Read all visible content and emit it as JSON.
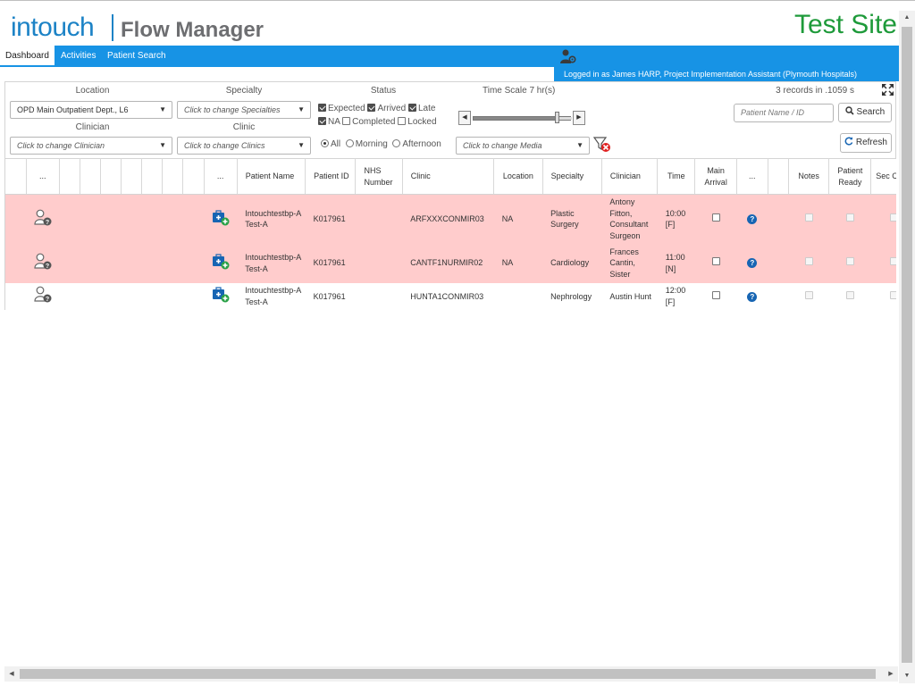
{
  "header": {
    "logo_main": "intouch",
    "logo_product": "Flow Manager",
    "site_label": "Test Site"
  },
  "nav": {
    "tabs": [
      {
        "label": "Dashboard",
        "active": true
      },
      {
        "label": "Activities",
        "active": false
      },
      {
        "label": "Patient Search",
        "active": false
      }
    ],
    "user_text": "Logged in as James HARP, Project Implementation Assistant (Plymouth Hospitals)"
  },
  "filters": {
    "location_label": "Location",
    "location_value": "OPD Main Outpatient Dept., L6",
    "specialty_label": "Specialty",
    "specialty_placeholder": "Click to change Specialties",
    "clinician_label": "Clinician",
    "clinician_placeholder": "Click to change Clinician",
    "clinic_label": "Clinic",
    "clinic_placeholder": "Click to change Clinics",
    "status_label": "Status",
    "status_options": [
      {
        "label": "Expected",
        "checked": true
      },
      {
        "label": "Arrived",
        "checked": true
      },
      {
        "label": "Late",
        "checked": true
      },
      {
        "label": "NA",
        "checked": true
      },
      {
        "label": "Completed",
        "checked": false
      },
      {
        "label": "Locked",
        "checked": false
      }
    ],
    "time_scale_label": "Time Scale",
    "time_scale_value": "7",
    "time_scale_unit": "hr(s)",
    "time_scale_fraction": 0.86,
    "session_options": [
      {
        "label": "All",
        "selected": true
      },
      {
        "label": "Morning",
        "selected": false
      },
      {
        "label": "Afternoon",
        "selected": false
      }
    ],
    "media_placeholder": "Click to change Media",
    "records_info": "3 records in .1059 s",
    "patient_search_placeholder": "Patient Name / ID",
    "search_button": "Search",
    "refresh_button": "Refresh"
  },
  "grid": {
    "columns": [
      "...",
      "...",
      "Patient Name",
      "Patient ID",
      "NHS Number",
      "Clinic",
      "Location",
      "Specialty",
      "Clinician",
      "Time",
      "Main Arrival",
      "...",
      "Notes",
      "Patient Ready",
      "Sec Clinic"
    ],
    "rows": [
      {
        "patient_name": "Intouchtestbp-A Test-A",
        "patient_id": "K017961",
        "nhs": "",
        "clinic": "ARFXXXCONMIR03",
        "location": "NA",
        "specialty": "Plastic Surgery",
        "clinician": "Antony Fitton, Consultant Surgeon",
        "time": "10:00 [F]",
        "late": true
      },
      {
        "patient_name": "Intouchtestbp-A Test-A",
        "patient_id": "K017961",
        "nhs": "",
        "clinic": "CANTF1NURMIR02",
        "location": "NA",
        "specialty": "Cardiology",
        "clinician": "Frances Cantin, Sister",
        "time": "11:00 [N]",
        "late": true
      },
      {
        "patient_name": "Intouchtestbp-A Test-A",
        "patient_id": "K017961",
        "nhs": "",
        "clinic": "HUNTA1CONMIR03",
        "location": "",
        "specialty": "Nephrology",
        "clinician": "Austin Hunt",
        "time": "12:00 [F]",
        "late": false
      }
    ]
  },
  "icons": {
    "user_settings": "user-gear-icon",
    "clear_filter": "filter-clear-icon",
    "expand": "expand-icon",
    "refresh": "refresh-icon",
    "patient": "patient-unknown-icon",
    "kit": "medical-kit-add-icon",
    "help": "question-icon"
  },
  "colors": {
    "brand_blue": "#1d83c6",
    "nav_blue": "#1793e5",
    "test_site_green": "#1e9a3a",
    "late_row": "#ffcccc",
    "help_icon": "#1765b3"
  }
}
